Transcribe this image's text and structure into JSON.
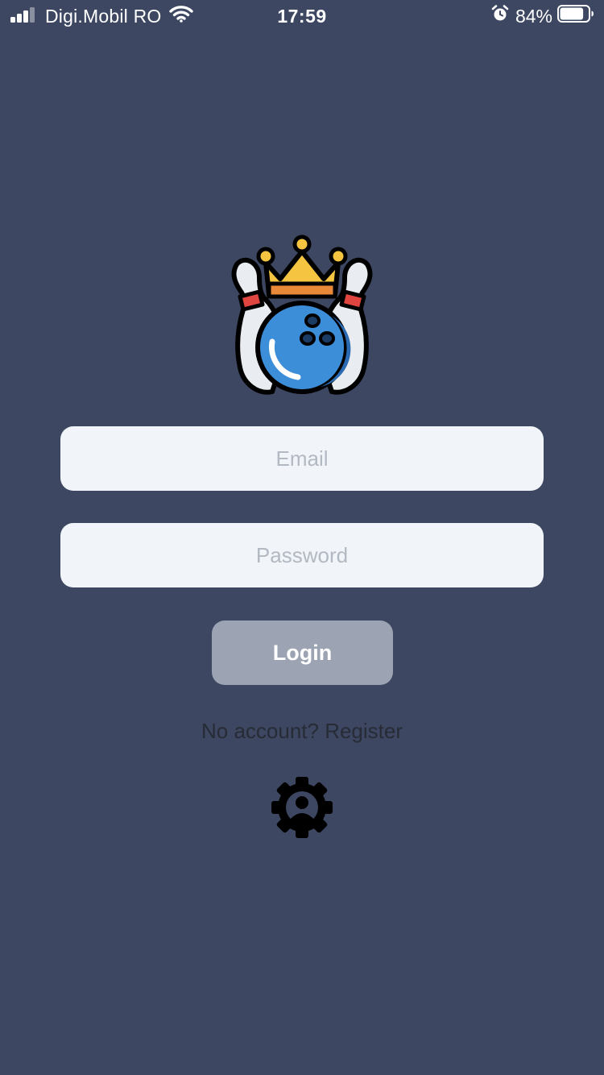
{
  "status_bar": {
    "carrier": "Digi.Mobil RO",
    "time": "17:59",
    "battery_percent": "84%",
    "battery_level": 0.84,
    "icons": [
      "signal-icon",
      "wifi-icon",
      "alarm-icon",
      "battery-icon"
    ]
  },
  "login_form": {
    "email_placeholder": "Email",
    "email_value": "",
    "password_placeholder": "Password",
    "password_value": "",
    "login_label": "Login",
    "register_text": "No account? Register"
  },
  "icons": {
    "logo": "bowling-crown-logo-icon",
    "settings": "gear-icon"
  },
  "colors": {
    "background": "#3d4762",
    "field_background": "#f1f4f8",
    "button_background": "#9ca3b3",
    "register_text": "#262b36"
  }
}
